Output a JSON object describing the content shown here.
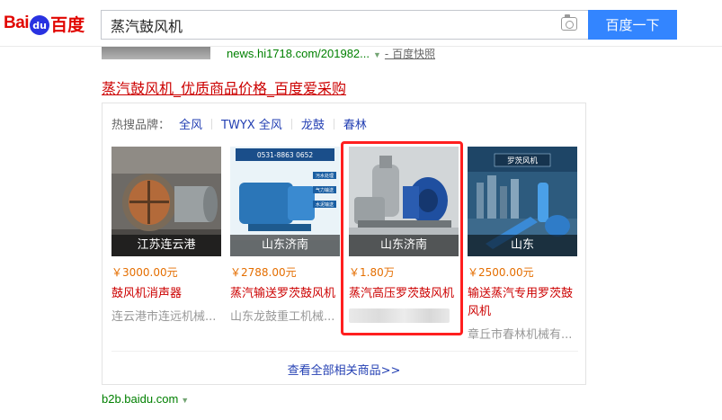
{
  "header": {
    "logo_text_latin": "Bai",
    "logo_paw": "du",
    "logo_text_cn": "百度",
    "search_value": "蒸汽鼓风机",
    "search_button": "百度一下"
  },
  "prev_result": {
    "url": "news.hi1718.com/201982...",
    "snapshot": "- 百度快照"
  },
  "result": {
    "title": "蒸汽鼓风机_优质商品价格_百度爱采购",
    "hot_label": "热搜品牌：",
    "brands": [
      "全风",
      "TWYX 全风",
      "龙鼓",
      "春林"
    ],
    "products": [
      {
        "location": "江苏连云港",
        "price": "￥3000.00元",
        "name": "鼓风机消声器",
        "seller": "连云港市连远机械..."
      },
      {
        "location": "山东济南",
        "price": "￥2788.00元",
        "name": "蒸汽输送罗茨鼓风机",
        "seller": "山东龙鼓重工机械..."
      },
      {
        "location": "山东济南",
        "price": "￥1.80万",
        "name": "蒸汽高压罗茨鼓风机",
        "seller": ""
      },
      {
        "location": "山东",
        "price": "￥2500.00元",
        "name": "输送蒸汽专用罗茨鼓风机",
        "seller": "章丘市春林机械有..."
      }
    ],
    "image_texts": {
      "phone": "0531-8863 0652",
      "tag1": "污水处理",
      "tag2": "气力输送",
      "tag3": "水泥输送",
      "brand_banner": "罗茨风机"
    },
    "see_all": "查看全部相关商品>>",
    "source": "b2b.baidu.com"
  },
  "colors": {
    "brand_red": "#e10601",
    "baidu_blue": "#3385ff",
    "link_blue": "#2440b3",
    "title_red": "#cc0000",
    "url_green": "#008000",
    "price_orange": "#e46e00",
    "highlight_red": "#ff1f1f"
  }
}
